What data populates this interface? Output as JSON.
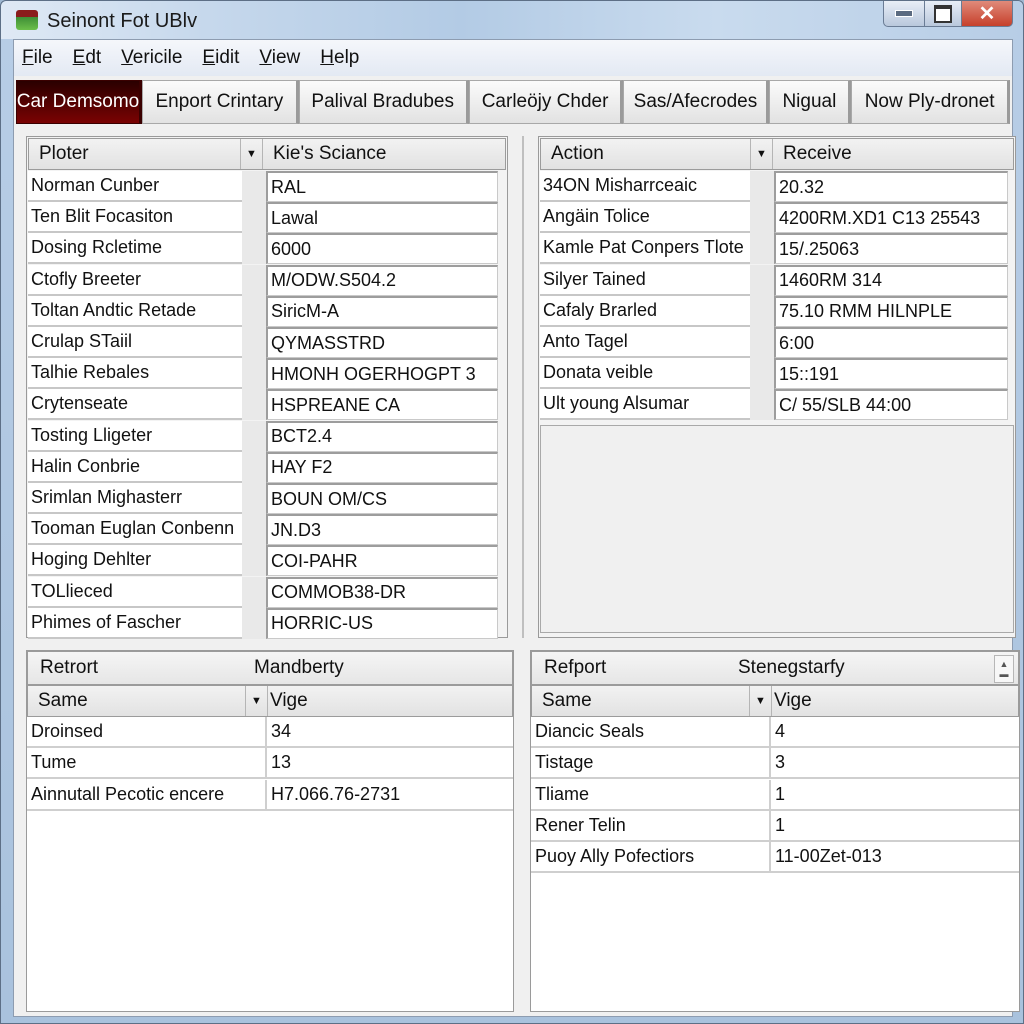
{
  "window": {
    "title": "Seinont Fot UBlv",
    "icons": {
      "app": "app-icon",
      "minimize": "minimize-icon",
      "maximize": "maximize-icon",
      "close": "close-icon"
    },
    "close_glyph": "✕"
  },
  "menu": [
    {
      "ul": "F",
      "rest": "ile"
    },
    {
      "ul": "E",
      "rest": "dt"
    },
    {
      "ul": "V",
      "rest": "ericile"
    },
    {
      "ul": "E",
      "rest": "idit"
    },
    {
      "ul": "V",
      "rest": "iew"
    },
    {
      "ul": "H",
      "rest": "elp"
    }
  ],
  "tabs": [
    {
      "label": "Car Demsomo",
      "active": true
    },
    {
      "label": "Enport Crintary"
    },
    {
      "label": "Palival Bradubes"
    },
    {
      "label": "Carleöjy Chder"
    },
    {
      "label": "Sas/Afecrodes"
    },
    {
      "label": "Nigual"
    },
    {
      "label": "Now Ply-dronet"
    }
  ],
  "left_grid": {
    "col1": "Ploter",
    "col2": "Kie's Sciance",
    "rows": [
      {
        "name": "Norman Cunber",
        "value": "RAL"
      },
      {
        "name": "Ten Blit Focasiton",
        "value": "Lawal"
      },
      {
        "name": "Dosing Rcletime",
        "value": "6000"
      },
      {
        "name": "Ctofly Breeter",
        "value": "M/ODW.S504.2"
      },
      {
        "name": "Toltan Andtic Retade",
        "value": "SiricM-A"
      },
      {
        "name": "Crulap STaiil",
        "value": "QYMASSTRD"
      },
      {
        "name": "Talhie Rebales",
        "value": "HMONH OGERHOGPT 3"
      },
      {
        "name": "Crytenseate",
        "value": "HSPREANE CA"
      },
      {
        "name": "Tosting Lligeter",
        "value": "BCT2.4"
      },
      {
        "name": "Halin Conbrie",
        "value": "HAY F2"
      },
      {
        "name": "Srimlan Mighasterr",
        "value": "BOUN OM/CS"
      },
      {
        "name": "Tooman Euglan Conbenn",
        "value": "JN.D3"
      },
      {
        "name": "Hoging Dehlter",
        "value": "COI-PAHR"
      },
      {
        "name": "TOLlieced",
        "value": "COMMOB38-DR"
      },
      {
        "name": "Phimes of Fascher",
        "value": "HORRIC-US"
      }
    ]
  },
  "right_grid": {
    "col1": "Action",
    "col2": "Receive",
    "rows": [
      {
        "name": "34ON Misharrceaic",
        "value": "20.32"
      },
      {
        "name": "Angäin Tolice",
        "value": "4200RM.XD1 C13 25543"
      },
      {
        "name": "Kamle Pat Conpers Tlote",
        "value": "15/.25063"
      },
      {
        "name": "Silyer Tained",
        "value": "1460RM 314"
      },
      {
        "name": "Cafaly Brarled",
        "value": "75.10 RMM HILNPLE"
      },
      {
        "name": "Anto Tagel",
        "value": "6:00"
      },
      {
        "name": "Donata veible",
        "value": "15::191"
      },
      {
        "name": "Ult young Alsumar",
        "value": "C/ 55/SLB 44:00"
      }
    ]
  },
  "report_left": {
    "title": "Retrort",
    "subtitle": "Mandberty",
    "col1": "Same",
    "col2": "Vige",
    "rows": [
      {
        "name": "Droinsed",
        "value": "34"
      },
      {
        "name": "Tume",
        "value": "13"
      },
      {
        "name": "Ainnutall Pecotic encere",
        "value": "H7.066.76-2731"
      }
    ]
  },
  "report_right": {
    "title": "Refport",
    "subtitle": "Stenegstarfy",
    "col1": "Same",
    "col2": "Vige",
    "rows": [
      {
        "name": "Diancic Seals",
        "value": "4"
      },
      {
        "name": "Tistage",
        "value": "3"
      },
      {
        "name": "Tliame",
        "value": "1"
      },
      {
        "name": "Rener Telin",
        "value": "1"
      },
      {
        "name": "Puoy Ally Pofectiors",
        "value": "11-00Zet-013"
      }
    ]
  },
  "glyphs": {
    "dropdown": "▼",
    "spin_up": "▲",
    "spin_down": "▬"
  },
  "colors": {
    "active_tab": "#6a0000",
    "close_button": "#c6402b"
  }
}
